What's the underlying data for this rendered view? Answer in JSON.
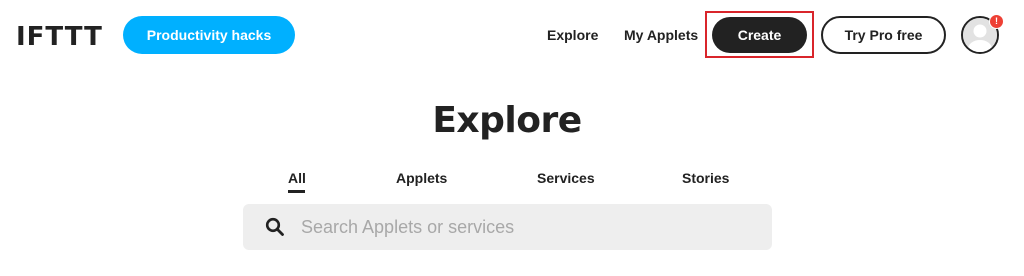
{
  "header": {
    "logo": "IFTTT",
    "promo_pill": "Productivity hacks",
    "nav": {
      "explore": "Explore",
      "my_applets": "My Applets",
      "create": "Create",
      "try_pro": "Try Pro free"
    },
    "notification_badge": "!"
  },
  "main": {
    "title": "Explore",
    "tabs": [
      {
        "label": "All",
        "active": true
      },
      {
        "label": "Applets",
        "active": false
      },
      {
        "label": "Services",
        "active": false
      },
      {
        "label": "Stories",
        "active": false
      }
    ],
    "search": {
      "placeholder": "Search Applets or services",
      "value": "",
      "icon": "search-icon"
    }
  },
  "colors": {
    "promo_blue": "#00b0ff",
    "dark": "#222222",
    "highlight_red": "#d9252b",
    "badge_red": "#ee4035",
    "search_bg": "#eeeeee"
  }
}
